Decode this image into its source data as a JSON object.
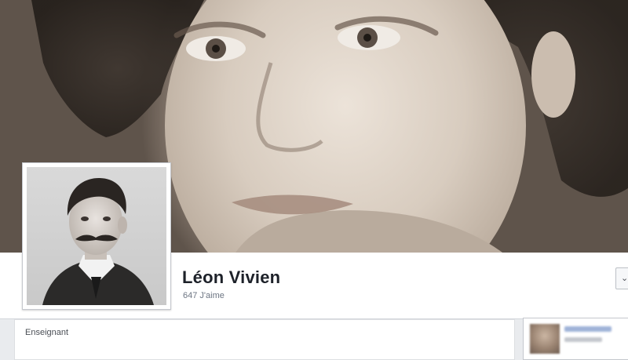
{
  "page": {
    "name": "Léon Vivien",
    "likes": "647 J'aime",
    "category": "Enseignant"
  },
  "icons": {
    "dropdown": "chevron-down-icon"
  },
  "colors": {
    "background": "#e9ebee",
    "panel": "#ffffff",
    "name_text": "#1d2129",
    "secondary_text": "#6d7583"
  }
}
